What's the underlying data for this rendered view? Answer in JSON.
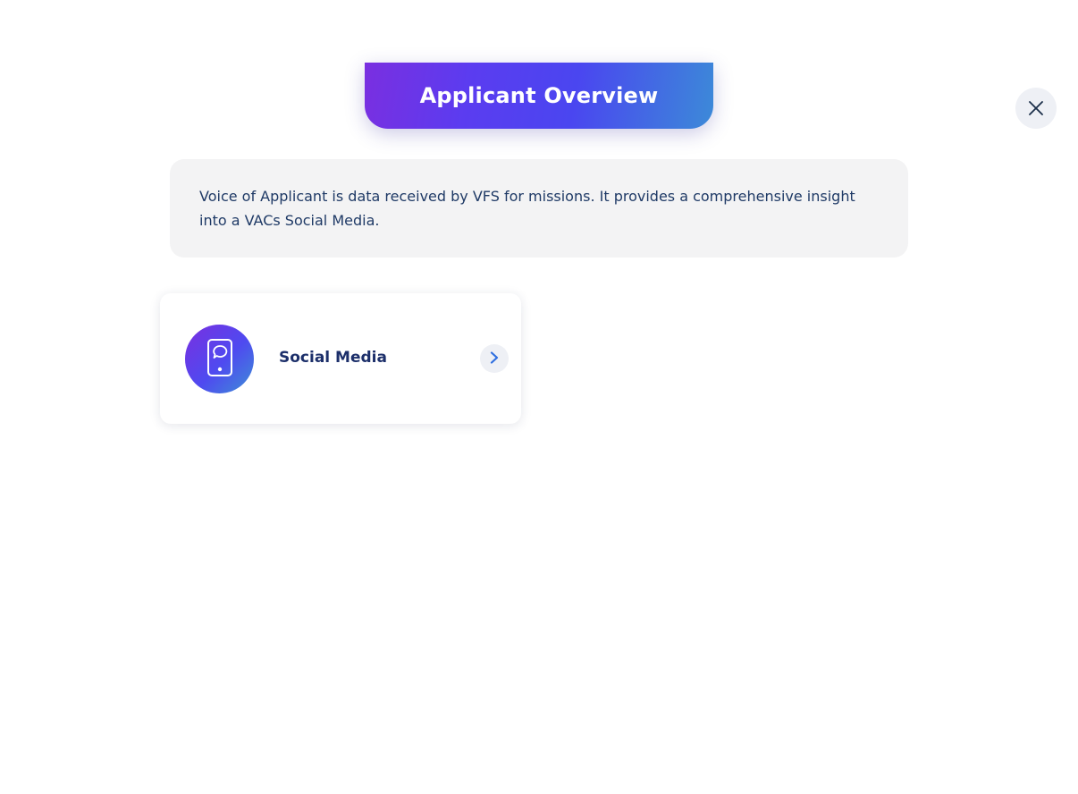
{
  "header": {
    "title": "Applicant Overview"
  },
  "close_button": {
    "icon": "close-icon"
  },
  "description": {
    "text": "Voice of Applicant is data received by VFS for missions. It provides a comprehensive insight into a VACs Social Media."
  },
  "cards": [
    {
      "label": "Social Media",
      "icon": "mobile-chat-icon",
      "action_icon": "chevron-right-icon"
    }
  ],
  "colors": {
    "gradient_start": "#7a2fe0",
    "gradient_mid": "#4f4af0",
    "gradient_end": "#3d8fd6",
    "text_dark_blue": "#1c2f6a",
    "description_bg": "#f3f3f4",
    "chevron_color": "#2f6fe0"
  }
}
